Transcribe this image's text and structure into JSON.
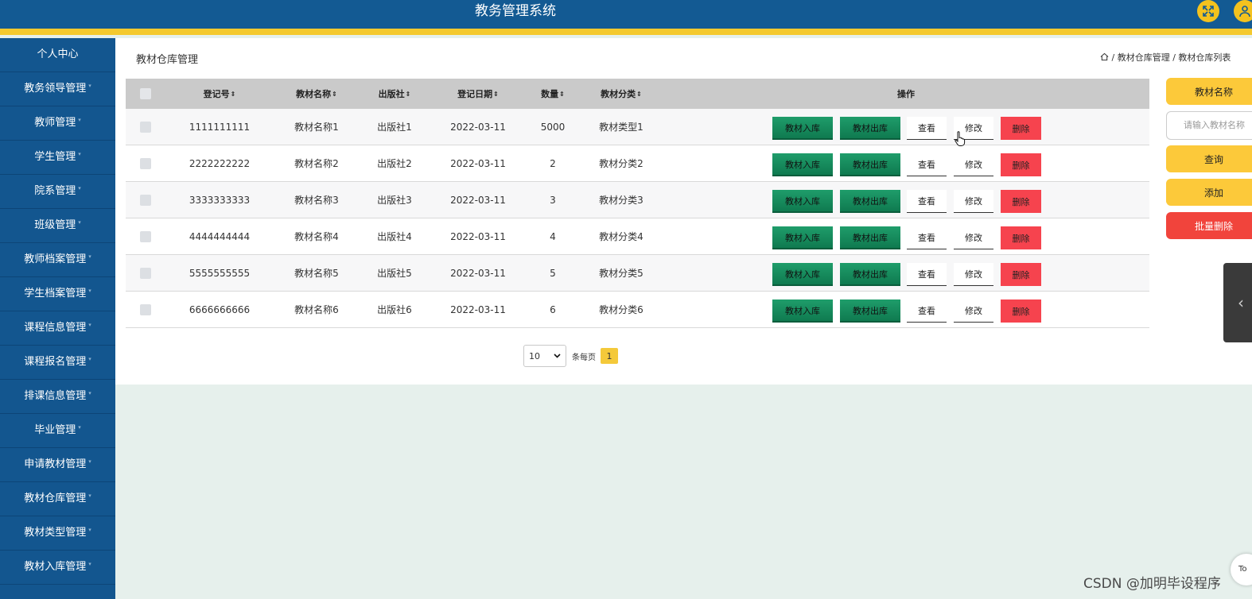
{
  "app": {
    "title": "教务管理系统",
    "accent_color": "#f4c92e",
    "primary_color": "#135a93"
  },
  "header": {
    "fullscreen_icon": "expand-icon",
    "user_icon": "user-icon"
  },
  "sidebar": {
    "items": [
      {
        "label": "个人中心"
      },
      {
        "label": "教务领导管理"
      },
      {
        "label": "教师管理"
      },
      {
        "label": "学生管理"
      },
      {
        "label": "院系管理"
      },
      {
        "label": "班级管理"
      },
      {
        "label": "教师档案管理"
      },
      {
        "label": "学生档案管理"
      },
      {
        "label": "课程信息管理"
      },
      {
        "label": "课程报名管理"
      },
      {
        "label": "排课信息管理"
      },
      {
        "label": "毕业管理"
      },
      {
        "label": "申请教材管理"
      },
      {
        "label": "教材仓库管理"
      },
      {
        "label": "教材类型管理"
      },
      {
        "label": "教材入库管理"
      }
    ]
  },
  "page": {
    "title": "教材仓库管理",
    "breadcrumb": [
      "教材仓库管理",
      "教材仓库列表"
    ]
  },
  "table": {
    "columns": {
      "reg_no": "登记号",
      "name": "教材名称",
      "publisher": "出版社",
      "reg_date": "登记日期",
      "quantity": "数量",
      "category": "教材分类",
      "actions": "操作"
    },
    "sort_icon": "⇕",
    "rows": [
      {
        "reg_no": "1111111111",
        "name": "教材名称1",
        "publisher": "出版社1",
        "reg_date": "2022-03-11",
        "quantity": "5000",
        "category": "教材类型1"
      },
      {
        "reg_no": "2222222222",
        "name": "教材名称2",
        "publisher": "出版社2",
        "reg_date": "2022-03-11",
        "quantity": "2",
        "category": "教材分类2"
      },
      {
        "reg_no": "3333333333",
        "name": "教材名称3",
        "publisher": "出版社3",
        "reg_date": "2022-03-11",
        "quantity": "3",
        "category": "教材分类3"
      },
      {
        "reg_no": "4444444444",
        "name": "教材名称4",
        "publisher": "出版社4",
        "reg_date": "2022-03-11",
        "quantity": "4",
        "category": "教材分类4"
      },
      {
        "reg_no": "5555555555",
        "name": "教材名称5",
        "publisher": "出版社5",
        "reg_date": "2022-03-11",
        "quantity": "5",
        "category": "教材分类5"
      },
      {
        "reg_no": "6666666666",
        "name": "教材名称6",
        "publisher": "出版社6",
        "reg_date": "2022-03-11",
        "quantity": "6",
        "category": "教材分类6"
      }
    ],
    "row_actions": {
      "stock_in": "教材入库",
      "stock_out": "教材出库",
      "view": "查看",
      "edit": "修改",
      "delete": "删除"
    }
  },
  "pagination": {
    "page_size": "10",
    "page_size_label": "条每页",
    "current_page": "1"
  },
  "search_panel": {
    "field_label": "教材名称",
    "placeholder": "请输入教材名称",
    "query_label": "查询",
    "add_label": "添加",
    "batch_delete_label": "批量删除"
  },
  "floating": {
    "to_top_label": "To"
  },
  "watermark": "CSDN @加明毕设程序"
}
